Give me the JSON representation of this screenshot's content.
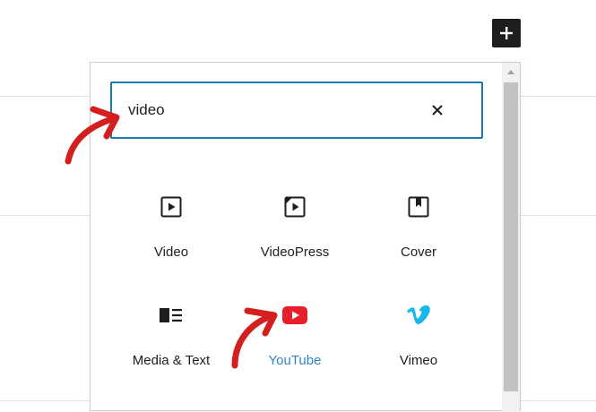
{
  "toolbar": {
    "add_icon": "plus-icon"
  },
  "inserter": {
    "search": {
      "value": "video",
      "clear_icon": "close-icon"
    },
    "blocks": [
      {
        "label": "Video",
        "icon": "video-icon"
      },
      {
        "label": "VideoPress",
        "icon": "videopress-icon"
      },
      {
        "label": "Cover",
        "icon": "cover-icon"
      },
      {
        "label": "Media & Text",
        "icon": "media-text-icon"
      },
      {
        "label": "YouTube",
        "icon": "youtube-icon",
        "highlighted": true
      },
      {
        "label": "Vimeo",
        "icon": "vimeo-icon"
      }
    ]
  },
  "colors": {
    "accent": "#1a7bb0",
    "link": "#3582c4",
    "youtube_red": "#e5202b",
    "vimeo_blue": "#1ab7ea",
    "annotation_red": "#d41f1f",
    "dark": "#1e1e1e"
  }
}
